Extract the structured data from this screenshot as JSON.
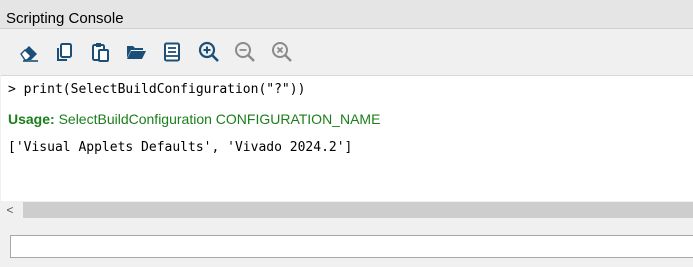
{
  "window": {
    "title": "Scripting Console"
  },
  "toolbar": {
    "buttons": [
      {
        "icon": "eraser-icon",
        "label": "Clear"
      },
      {
        "icon": "copy-icon",
        "label": "Copy"
      },
      {
        "icon": "paste-icon",
        "label": "Paste"
      },
      {
        "icon": "open-folder-icon",
        "label": "Open"
      },
      {
        "icon": "script-icon",
        "label": "Script"
      },
      {
        "icon": "zoom-in-icon",
        "label": "Zoom In"
      },
      {
        "icon": "zoom-out-icon",
        "label": "Zoom Out"
      },
      {
        "icon": "zoom-reset-icon",
        "label": "Reset Zoom"
      }
    ],
    "icon_color": "#1c4f78",
    "icon_disabled_color": "#8a8a8a"
  },
  "console": {
    "command_line": "> print(SelectBuildConfiguration(\"?\"))",
    "usage_label": "Usage:",
    "usage_text": " SelectBuildConfiguration CONFIGURATION_NAME",
    "output_line": "['Visual Applets Defaults', 'Vivado 2024.2']",
    "usage_color": "#1a7f1a"
  },
  "scrollbar": {
    "left_arrow": "<"
  },
  "input": {
    "value": "",
    "placeholder": ""
  }
}
